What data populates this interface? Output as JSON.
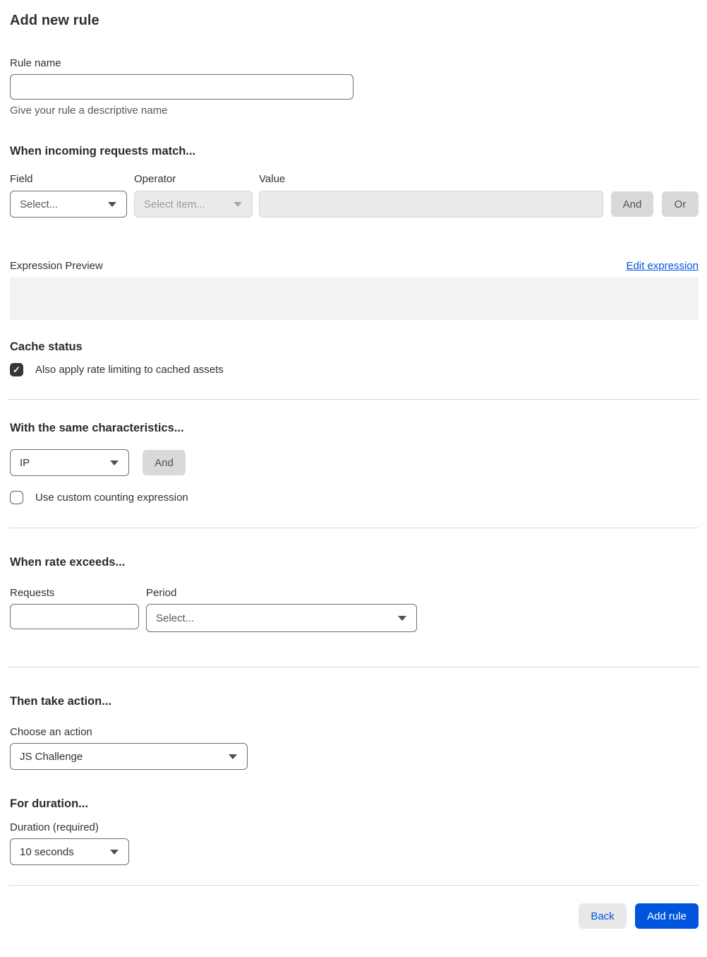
{
  "page": {
    "title": "Add new rule"
  },
  "rule_name": {
    "label": "Rule name",
    "value": "",
    "helper": "Give your rule a descriptive name"
  },
  "match_section": {
    "heading": "When incoming requests match...",
    "field_label": "Field",
    "field_value": "Select...",
    "operator_label": "Operator",
    "operator_value": "Select item...",
    "value_label": "Value",
    "value_value": "",
    "and_label": "And",
    "or_label": "Or"
  },
  "expression": {
    "preview_label": "Expression Preview",
    "edit_link_label": "Edit expression",
    "preview_value": ""
  },
  "cache_status": {
    "heading": "Cache status",
    "checkbox_label": "Also apply rate limiting to cached assets",
    "checked": true
  },
  "characteristics": {
    "heading": "With the same characteristics...",
    "selected_value": "IP",
    "and_label": "And",
    "checkbox_label": "Use custom counting expression",
    "checked": false
  },
  "rate": {
    "heading": "When rate exceeds...",
    "requests_label": "Requests",
    "requests_value": "",
    "period_label": "Period",
    "period_value": "Select..."
  },
  "action": {
    "heading": "Then take action...",
    "label": "Choose an action",
    "selected_value": "JS Challenge"
  },
  "duration": {
    "heading": "For duration...",
    "label": "Duration (required)",
    "selected_value": "10 seconds"
  },
  "footer": {
    "back_label": "Back",
    "add_rule_label": "Add rule"
  },
  "icons": {
    "check": "✓"
  },
  "colors": {
    "accent_blue": "#0055dc",
    "disabled_bg": "#ebebeb",
    "gray_button_bg": "#d9d9d9",
    "preview_bg": "#f2f2f2",
    "divider": "#d9d9d9",
    "checkbox_checked_bg": "#36363c",
    "text_primary": "#313131"
  }
}
